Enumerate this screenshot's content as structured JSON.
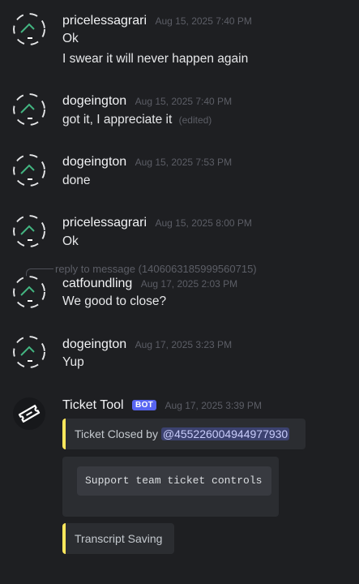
{
  "messages": [
    {
      "author": "pricelessagrari",
      "timestamp": "Aug 15, 2025 7:40 PM",
      "lines": [
        "Ok",
        "I swear it will never happen again"
      ]
    },
    {
      "author": "dogeington",
      "timestamp": "Aug 15, 2025 7:40 PM",
      "lines": [
        "got it, I appreciate it"
      ],
      "edited": "(edited)"
    },
    {
      "author": "dogeington",
      "timestamp": "Aug 15, 2025 7:53 PM",
      "lines": [
        "done"
      ]
    },
    {
      "author": "pricelessagrari",
      "timestamp": "Aug 15, 2025 8:00 PM",
      "lines": [
        "Ok"
      ]
    },
    {
      "author": "catfoundling",
      "timestamp": "Aug 17, 2025 2:03 PM",
      "lines": [
        "We good to close?"
      ],
      "reply": "reply to message (1406063185999560715)"
    },
    {
      "author": "dogeington",
      "timestamp": "Aug 17, 2025 3:23 PM",
      "lines": [
        "Yup"
      ]
    }
  ],
  "bot_message": {
    "author": "Ticket Tool",
    "badge": "BOT",
    "timestamp": "Aug 17, 2025 3:39 PM",
    "embed1": {
      "prefix": "Ticket Closed by",
      "mention": "@455226004944977930"
    },
    "embed2": {
      "button": "Support team ticket controls"
    },
    "embed3": {
      "text": "Transcript Saving"
    }
  },
  "colors": {
    "background": "#1e1f22",
    "embed_accent": "#fee75c",
    "bot_badge": "#5865f2"
  }
}
